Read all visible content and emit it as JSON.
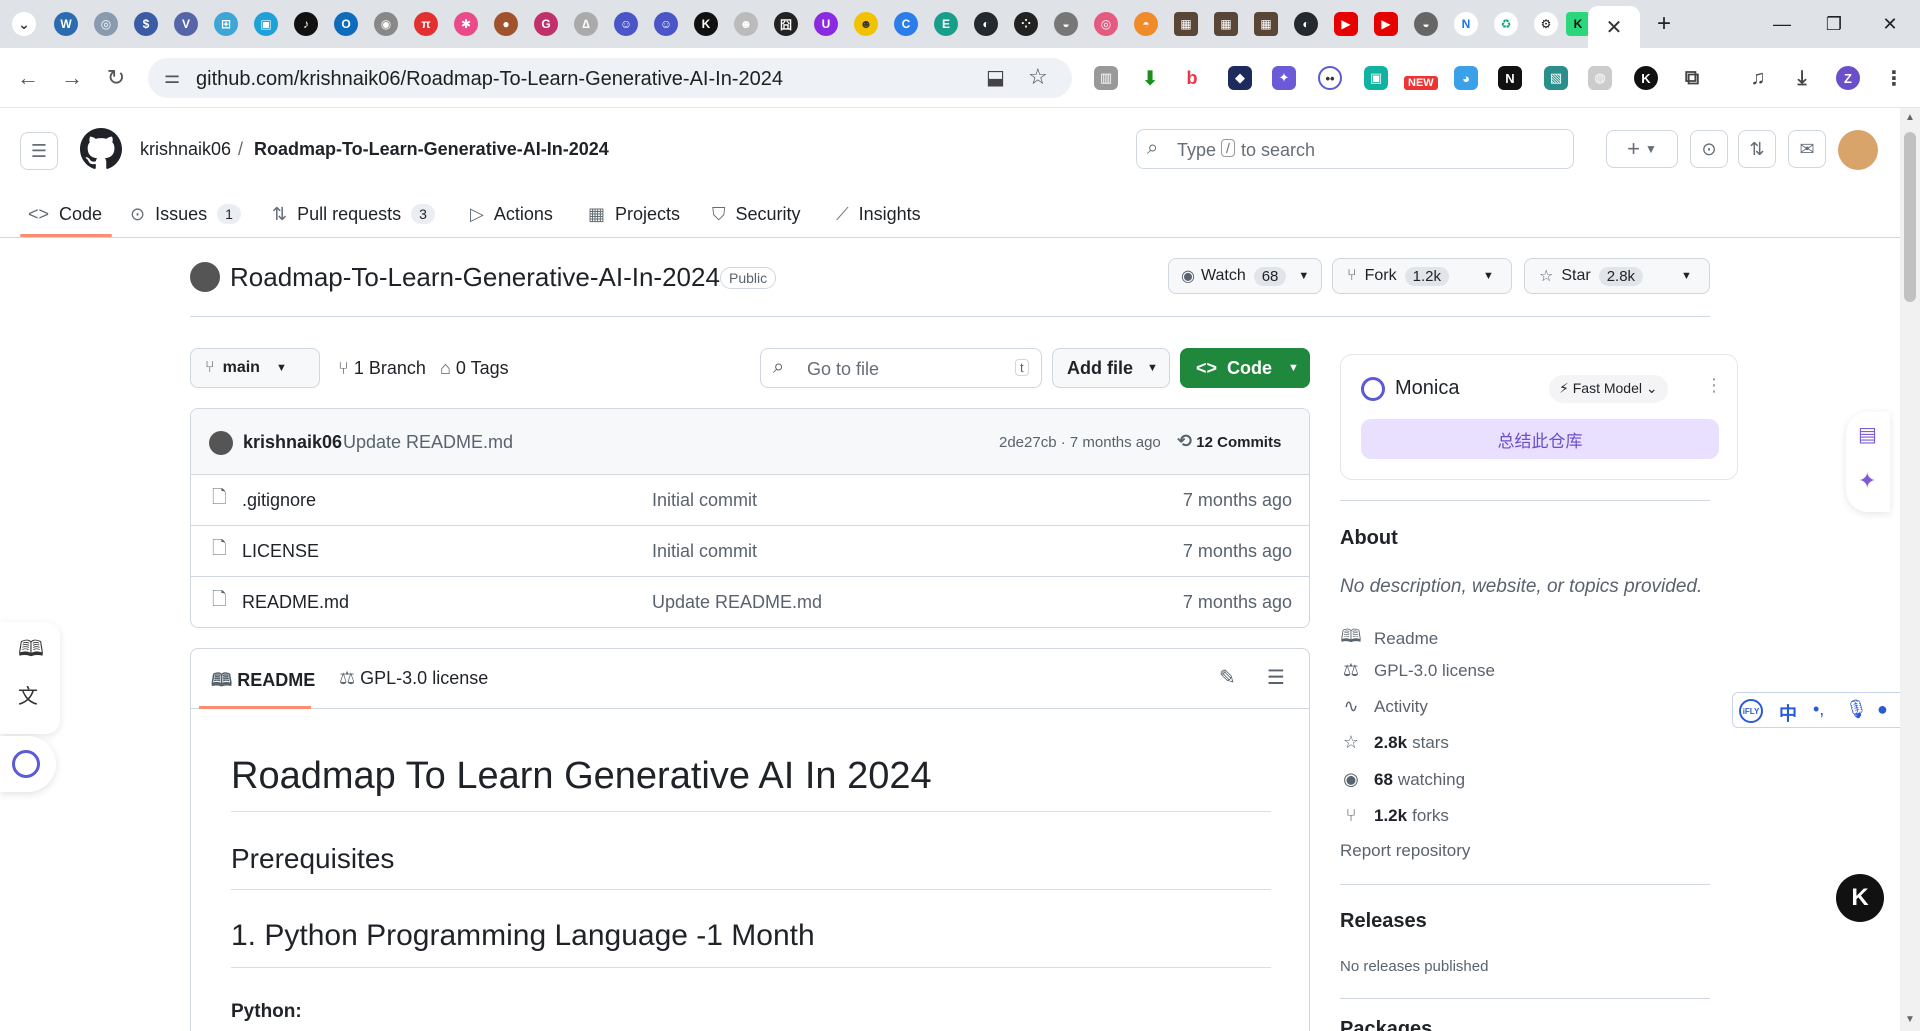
{
  "browser": {
    "url": "github.com/krishnaik06/Roadmap-To-Learn-Generative-AI-In-2024",
    "active_tab_close": "✕",
    "ext_new_badge": "NEW"
  },
  "header": {
    "owner": "krishnaik06",
    "separator": "/",
    "repo": "Roadmap-To-Learn-Generative-AI-In-2024",
    "search_placeholder_pre": "Type",
    "search_key": "/",
    "search_placeholder_post": "to search"
  },
  "tabs": [
    {
      "label": "Code",
      "icon": "code-icon"
    },
    {
      "label": "Issues",
      "count": "1",
      "icon": "issue-icon"
    },
    {
      "label": "Pull requests",
      "count": "3",
      "icon": "pull-request-icon"
    },
    {
      "label": "Actions",
      "icon": "play-icon"
    },
    {
      "label": "Projects",
      "icon": "table-icon"
    },
    {
      "label": "Security",
      "icon": "shield-icon"
    },
    {
      "label": "Insights",
      "icon": "graph-icon"
    }
  ],
  "repo": {
    "title": "Roadmap-To-Learn-Generative-AI-In-2024",
    "visibility": "Public",
    "watch_label": "Watch",
    "watch_count": "68",
    "fork_label": "Fork",
    "fork_count": "1.2k",
    "star_label": "Star",
    "star_count": "2.8k"
  },
  "toolbar": {
    "branch": "main",
    "branches": "1 Branch",
    "tags": "0 Tags",
    "goto_placeholder": "Go to file",
    "goto_key": "t",
    "add_file": "Add file",
    "code_button": "Code"
  },
  "commit": {
    "author": "krishnaik06",
    "message": "Update README.md",
    "hash_time": "2de27cb · 7 months ago",
    "commits": "12 Commits"
  },
  "files": [
    {
      "name": ".gitignore",
      "message": "Initial commit",
      "time": "7 months ago"
    },
    {
      "name": "LICENSE",
      "message": "Initial commit",
      "time": "7 months ago"
    },
    {
      "name": "README.md",
      "message": "Update README.md",
      "time": "7 months ago"
    }
  ],
  "readme": {
    "tab_readme": "README",
    "tab_license": "GPL-3.0 license",
    "h1": "Roadmap To Learn Generative AI In 2024",
    "h2a": "Prerequisites",
    "h2b": "1. Python Programming Language -1 Month",
    "p": "Python:"
  },
  "monica": {
    "name": "Monica",
    "model": "Fast Model",
    "summarize": "总结此仓库"
  },
  "about": {
    "title": "About",
    "desc": "No description, website, or topics provided.",
    "readme": "Readme",
    "license": "GPL-3.0 license",
    "activity": "Activity",
    "stars_num": "2.8k",
    "stars_label": "stars",
    "watching_num": "68",
    "watching_label": "watching",
    "forks_num": "1.2k",
    "forks_label": "forks",
    "report": "Report repository"
  },
  "releases": {
    "title": "Releases",
    "none": "No releases published",
    "next_partial": "Packages"
  },
  "ifly": {
    "logo": "iFLY",
    "zh": "中"
  },
  "colors": {
    "accent_green": "#1f883d",
    "tab_underline": "#fd8c73",
    "monica_purple": "#e9e0ff"
  }
}
